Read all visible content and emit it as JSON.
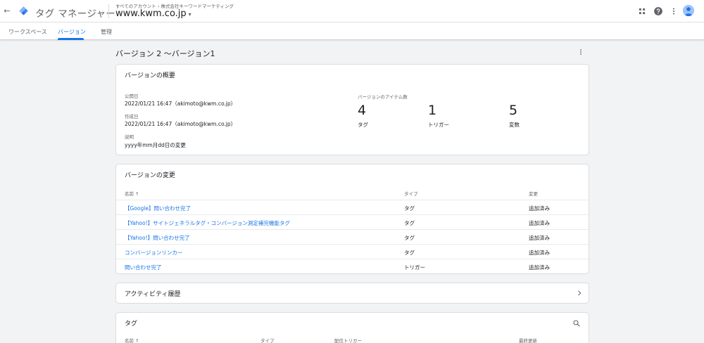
{
  "app": {
    "title": "タグ マネージャー",
    "breadcrumb": "すべてのアカウント › 株式会社キーワードマーケティング",
    "container": "www.kwm.co.jp",
    "caret": "▾",
    "back_glyph": "←"
  },
  "tabs": [
    {
      "label": "ワークスペース",
      "active": false
    },
    {
      "label": "バージョン",
      "active": true
    },
    {
      "label": "管理",
      "active": false
    }
  ],
  "page": {
    "title": "バージョン 2 ～バージョン1"
  },
  "summary": {
    "title": "バージョンの概要",
    "published_label": "公開日",
    "published_value": "2022/01/21 16:47（akimoto@kwm.co.jp）",
    "created_label": "作成日",
    "created_value": "2022/01/21 16:47（akimoto@kwm.co.jp）",
    "description_label": "説明",
    "description_value": "yyyy年mm月dd日の変更",
    "items_label": "バージョンのアイテム数",
    "counts": [
      {
        "value": "4",
        "label": "タグ"
      },
      {
        "value": "1",
        "label": "トリガー"
      },
      {
        "value": "5",
        "label": "変数"
      }
    ]
  },
  "changes": {
    "title": "バージョンの変更",
    "headers": {
      "name": "名前 ↑",
      "type": "タイプ",
      "change": "変更"
    },
    "rows": [
      {
        "name": "【Google】問い合わせ完了",
        "type": "タグ",
        "change": "追加済み"
      },
      {
        "name": "【Yahoo!】サイトジェネラルタグ・コンバージョン測定補完機能タグ",
        "type": "タグ",
        "change": "追加済み"
      },
      {
        "name": "【Yahoo!】問い合わせ完了",
        "type": "タグ",
        "change": "追加済み"
      },
      {
        "name": "コンバージョンリンカー",
        "type": "タグ",
        "change": "追加済み"
      },
      {
        "name": "問い合わせ完了",
        "type": "トリガー",
        "change": "追加済み"
      }
    ]
  },
  "activity": {
    "title": "アクティビティ履歴"
  },
  "tags_section": {
    "title": "タグ",
    "headers": {
      "name": "名前 ↑",
      "type": "タイプ",
      "trigger": "配信トリガー",
      "updated": "最終更新"
    }
  },
  "colors": {
    "accent": "#1a73e8",
    "background": "#f1f3f4",
    "card": "#ffffff"
  },
  "icons": {
    "back": "arrow-back-icon",
    "logo": "tag-manager-logo",
    "apps": "apps-grid-icon",
    "help": "help-icon",
    "more": "more-vert-icon",
    "chevron": "chevron-right-icon",
    "search": "search-icon"
  }
}
